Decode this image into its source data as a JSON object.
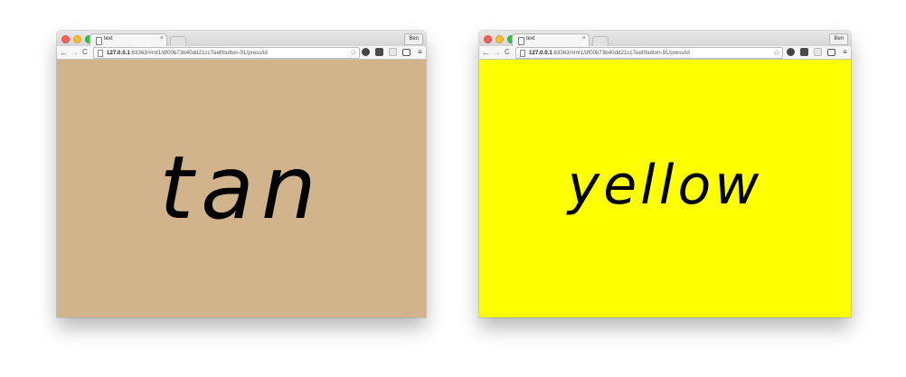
{
  "windows": [
    {
      "tab_title": "text",
      "tab_close": "×",
      "profile": "Ben",
      "url_host": "127.0.0.1",
      "url_rest": ":63363/#mt1/df00b73b40dd21cc7eef/button-91/press/id",
      "bg_color": "#d2b48c",
      "word": "tan"
    },
    {
      "tab_title": "text",
      "tab_close": "×",
      "profile": "Ben",
      "url_host": "127.0.0.1",
      "url_rest": ":63363/#mt1/df00b73b40dd21cc7eef/button-91/press/id",
      "bg_color": "#ffff00",
      "word": "yellow"
    }
  ],
  "icons": {
    "back": "←",
    "forward": "→",
    "reload": "C",
    "star": "☆",
    "menu": "≡"
  }
}
